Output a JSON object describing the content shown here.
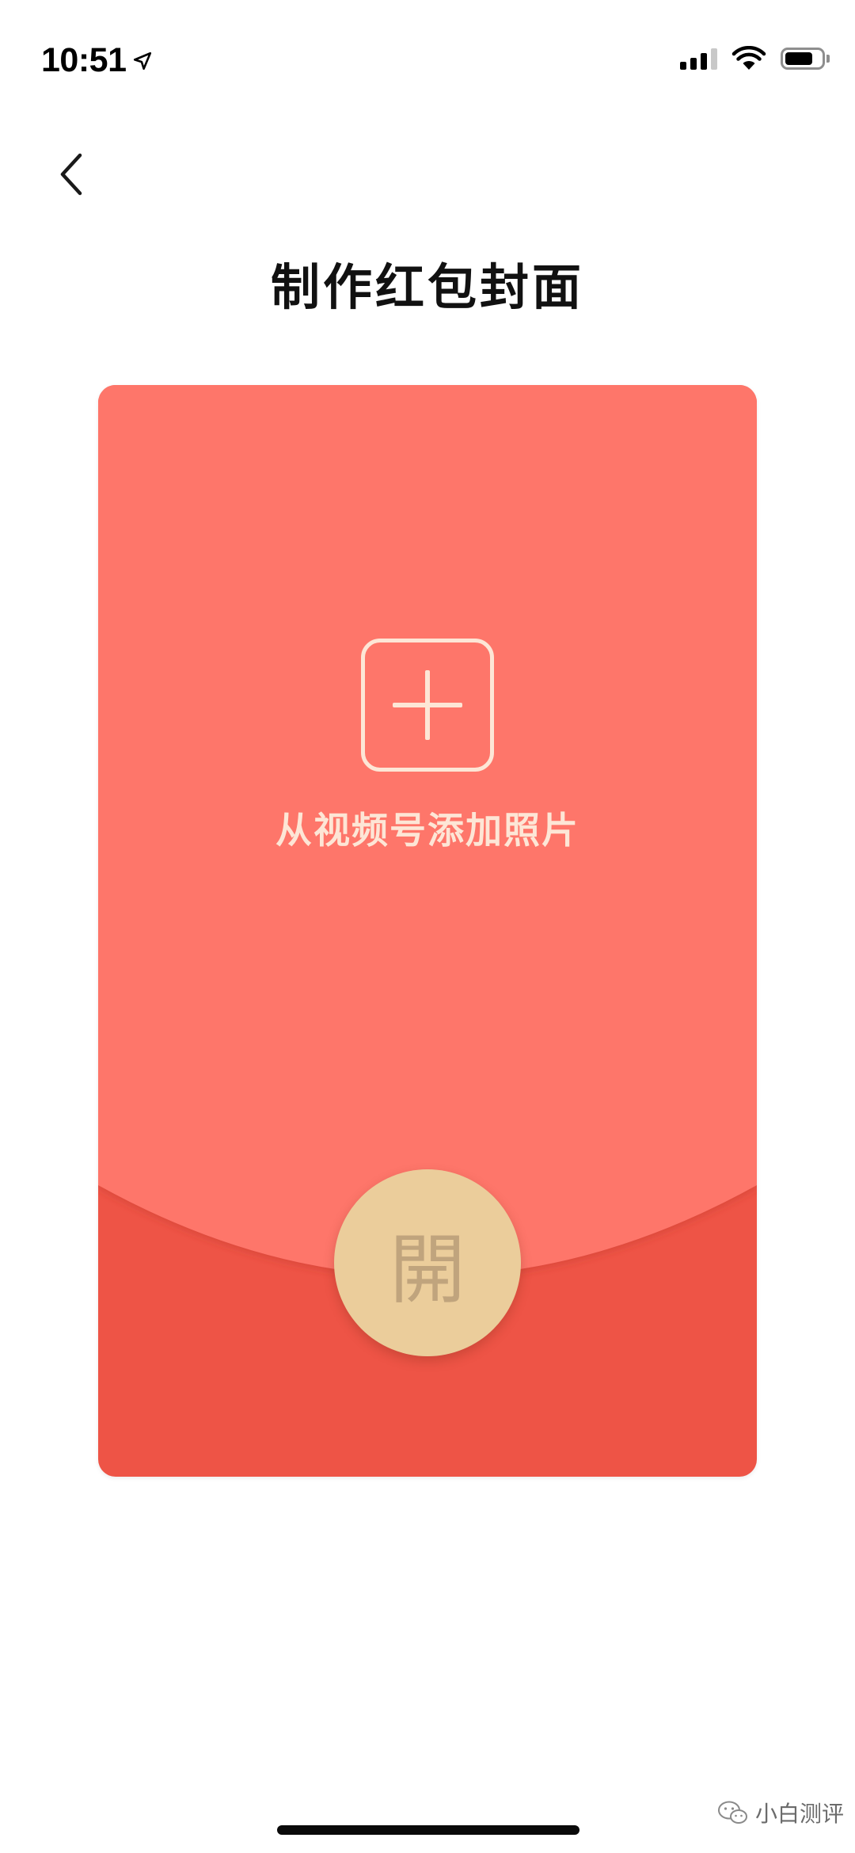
{
  "status_bar": {
    "time": "10:51",
    "battery_level": 0.78
  },
  "navigation": {
    "back_icon": "chevron-left-icon"
  },
  "page": {
    "title": "制作红包封面"
  },
  "envelope": {
    "add_photo_label": "从视频号添加照片",
    "open_label": "開",
    "colors": {
      "top": "#fe766b",
      "bottom": "#ee5446",
      "open_button": "#ebcd9b",
      "icon_stroke": "#fde6d6"
    }
  },
  "watermark": {
    "text": "小白测评",
    "icon": "wechat-icon"
  }
}
